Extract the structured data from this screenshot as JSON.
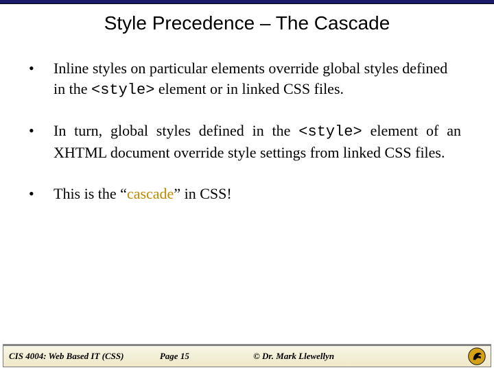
{
  "title": "Style Precedence – The Cascade",
  "bullets": [
    {
      "pre": "Inline styles on particular elements override global styles defined in the ",
      "code": "<style>",
      "post": " element or in linked CSS files.",
      "justify": false,
      "highlight": ""
    },
    {
      "pre": "In turn, global styles defined in the ",
      "code": "<style>",
      "post": " element of an XHTML document override style settings from linked CSS files.",
      "justify": true,
      "highlight": ""
    },
    {
      "pre": "This is the “",
      "code": "",
      "post": "” in CSS!",
      "justify": false,
      "highlight": "cascade"
    }
  ],
  "footer": {
    "course": "CIS 4004: Web Based IT (CSS)",
    "page": "Page 15",
    "copyright": "© Dr. Mark Llewellyn"
  },
  "colors": {
    "rule": "#1a1a6a",
    "highlight": "#c08a00"
  }
}
